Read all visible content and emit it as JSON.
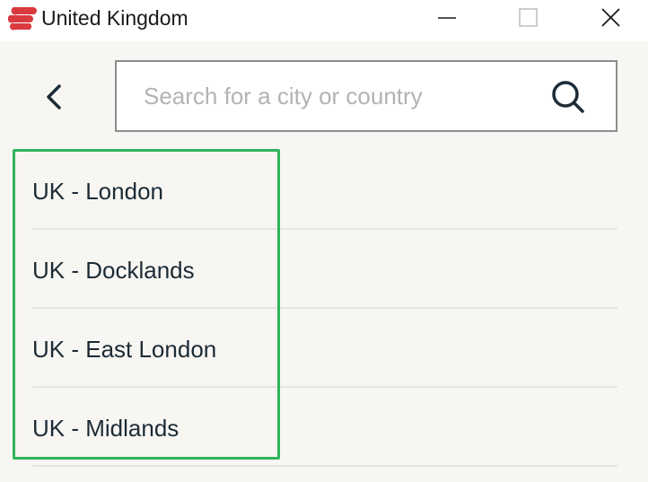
{
  "window": {
    "title": "United Kingdom"
  },
  "titlebar_buttons": {
    "minimize": "minimize-icon",
    "maximize": "maximize-icon",
    "close": "close-icon"
  },
  "nav": {
    "back_icon": "chevron-left-icon"
  },
  "search": {
    "placeholder": "Search for a city or country",
    "value": "",
    "icon": "search-icon"
  },
  "locations": [
    {
      "label": "UK - London"
    },
    {
      "label": "UK - Docklands"
    },
    {
      "label": "UK - East London"
    },
    {
      "label": "UK - Midlands"
    }
  ],
  "colors": {
    "brand_red": "#da3940",
    "text_dark": "#1c2b36",
    "background": "#f7f6f2",
    "highlight_green": "#2fb45b"
  }
}
